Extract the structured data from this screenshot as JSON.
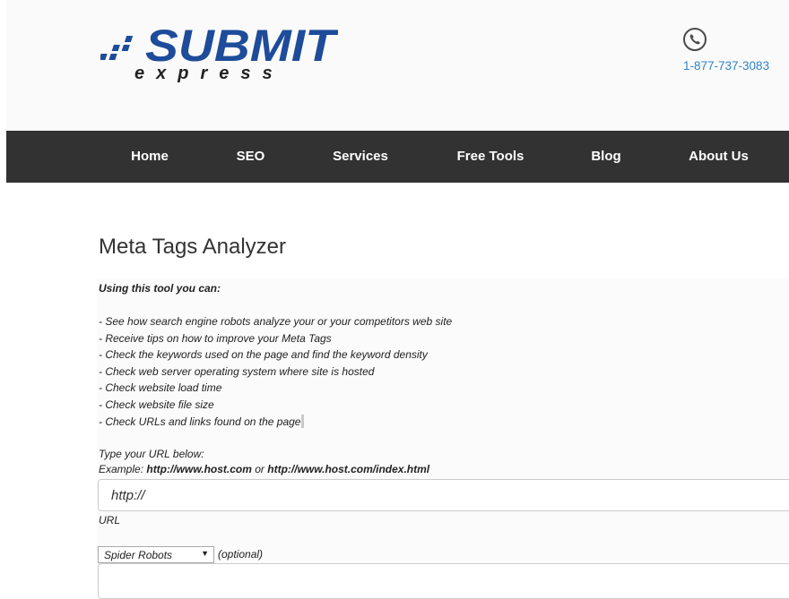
{
  "header": {
    "logo": {
      "name": "Submit Express",
      "word_main": "SUBMIT",
      "word_sub": "express",
      "color_main": "#1e4c9a",
      "color_sub": "#222222"
    },
    "phone": {
      "icon": "phone-icon",
      "number": "1-877-737-3083",
      "color": "#2f84c7"
    }
  },
  "nav": {
    "background": "#323232",
    "items": [
      {
        "label": "Home"
      },
      {
        "label": "SEO"
      },
      {
        "label": "Services"
      },
      {
        "label": "Free Tools"
      },
      {
        "label": "Blog"
      },
      {
        "label": "About Us"
      }
    ]
  },
  "main": {
    "title": "Meta Tags Analyzer",
    "intro": "Using this tool you can:",
    "features": [
      "- See how search engine robots analyze your or your competitors web site",
      "- Receive tips on how to improve your Meta Tags",
      "- Check the keywords used on the page and find the keyword density",
      "- Check web server operating system where site is hosted",
      "- Check website load time",
      "- Check website file size",
      "- Check URLs and links found on the page"
    ],
    "type_url_label": "Type your URL below:",
    "example": {
      "prefix": "Example: ",
      "url1": "http://www.host.com",
      "separator": " or ",
      "url2": "http://www.host.com/index.html"
    },
    "url_input": {
      "value": "http://",
      "label": "URL"
    },
    "spider_select": {
      "selected": "Spider Robots",
      "arrow": "▼"
    },
    "optional_label": "(optional)"
  }
}
